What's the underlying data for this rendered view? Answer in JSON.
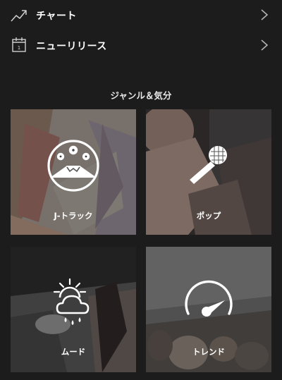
{
  "nav": {
    "items": [
      {
        "label": "チャート",
        "icon": "trending-up-icon"
      },
      {
        "label": "ニューリリース",
        "icon": "calendar-icon",
        "icon_text": "1"
      }
    ]
  },
  "section": {
    "title": "ジャンル＆気分"
  },
  "tiles": [
    {
      "label": "J-トラック",
      "icon": "mount-fuji-sakura-icon"
    },
    {
      "label": "ポップ",
      "icon": "microphone-icon"
    },
    {
      "label": "ムード",
      "icon": "weather-sun-cloud-rain-icon"
    },
    {
      "label": "トレンド",
      "icon": "gauge-icon"
    }
  ],
  "colors": {
    "background": "#1c1c1c",
    "text": "#ffffff",
    "chevron": "#b3b3b3"
  }
}
